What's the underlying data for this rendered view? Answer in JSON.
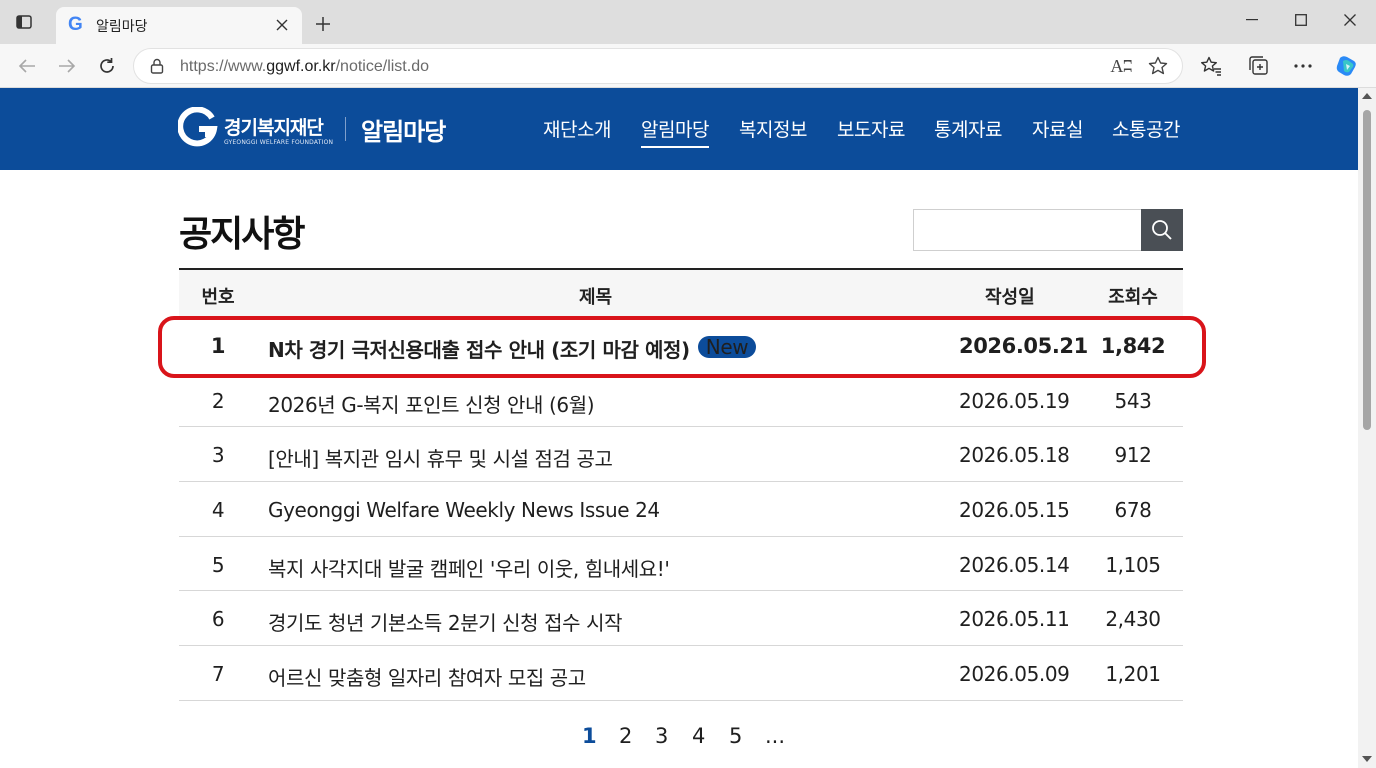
{
  "browser": {
    "tab_title": "알림마당",
    "favicon_letter": "G",
    "url_prefix": "https://www.",
    "url_domain": "ggwf.or.kr",
    "url_path": "/notice/list.do",
    "read_aloud_glyph": "Aʭ"
  },
  "site": {
    "logo_name": "경기복지재단",
    "logo_english": "GYEONGGI WELFARE FOUNDATION",
    "section_title": "알림마당",
    "nav": [
      "재단소개",
      "알림마당",
      "복지정보",
      "보도자료",
      "통계자료",
      "자료실",
      "소통공간"
    ],
    "nav_active_index": 1,
    "brand_color": "#0c4c9a"
  },
  "page": {
    "title": "공지사항",
    "search_placeholder": ""
  },
  "board": {
    "headers": {
      "num": "번호",
      "title": "제목",
      "date": "작성일",
      "views": "조회수"
    },
    "rows": [
      {
        "num": "1",
        "title": "N차 경기 극저신용대출 접수 안내 (조기 마감 예정)",
        "badge": "New",
        "date": "2026.05.21",
        "views": "1,842"
      },
      {
        "num": "2",
        "title": "2026년 G-복지 포인트 신청 안내 (6월)",
        "date": "2026.05.19",
        "views": "543"
      },
      {
        "num": "3",
        "title": "[안내] 복지관 임시 휴무 및 시설 점검 공고",
        "date": "2026.05.18",
        "views": "912"
      },
      {
        "num": "4",
        "title": "Gyeonggi Welfare Weekly News Issue 24",
        "date": "2026.05.15",
        "views": "678"
      },
      {
        "num": "5",
        "title": "복지 사각지대 발굴 캠페인 '우리 이웃, 힘내세요!'",
        "date": "2026.05.14",
        "views": "1,105"
      },
      {
        "num": "6",
        "title": "경기도 청년 기본소득 2분기 신청 접수 시작",
        "date": "2026.05.11",
        "views": "2,430"
      },
      {
        "num": "7",
        "title": "어르신 맞춤형 일자리 참여자 모집 공고",
        "date": "2026.05.09",
        "views": "1,201"
      }
    ]
  },
  "pagination": {
    "pages": [
      "1",
      "2",
      "3",
      "4",
      "5"
    ],
    "ellipsis": "...",
    "current": "1"
  }
}
